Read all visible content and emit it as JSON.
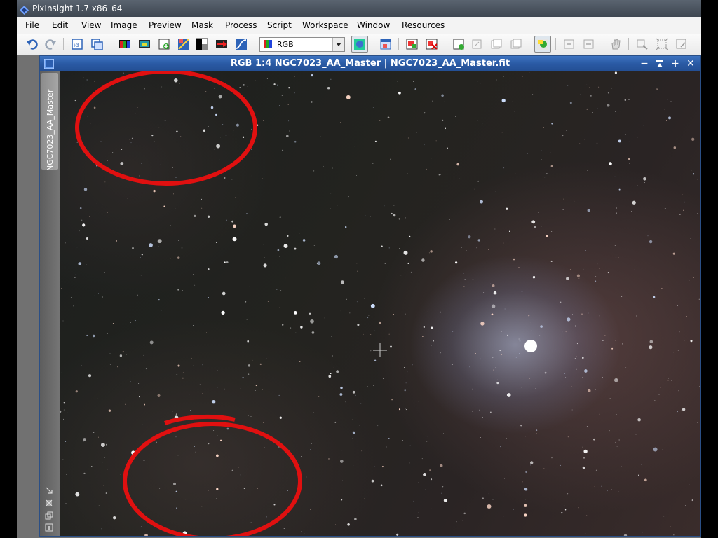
{
  "app": {
    "title": "PixInsight 1.7 x86_64"
  },
  "menubar": {
    "items": [
      "File",
      "Edit",
      "View",
      "Image",
      "Preview",
      "Mask",
      "Process",
      "Script",
      "Workspace",
      "Window",
      "Resources"
    ]
  },
  "toolbar": {
    "color_mode_select": "RGB"
  },
  "image_window": {
    "title": "RGB 1:4 NGC7023_AA_Master | NGC7023_AA_Master.fit",
    "side_tab_label": "NGC7023_AA_Master",
    "buttons": {
      "minimize": "−",
      "shade": "⯬",
      "maximize": "+",
      "close": "✕"
    }
  },
  "annotations": {
    "circle_color": "#e01010",
    "count": 2
  },
  "colors": {
    "window_title": "#2a5aa4",
    "menubar_bg": "#f3f3f3",
    "workspace_bg": "#717171"
  }
}
